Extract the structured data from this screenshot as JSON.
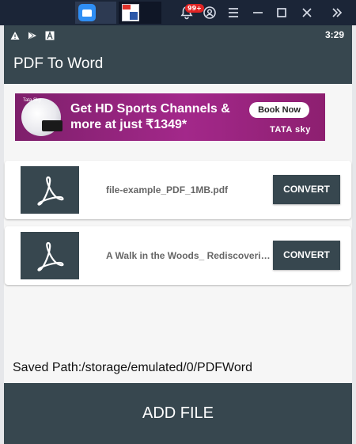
{
  "emulator": {
    "notification_badge": "99+"
  },
  "status_bar": {
    "time": "3:29",
    "icons": [
      "warning-icon",
      "play-store-icon",
      "font-icon"
    ]
  },
  "app_bar": {
    "title": "PDF To Word"
  },
  "ad_banner": {
    "headline": "Get HD Sports Channels & more at just ₹1349*",
    "cta": "Book Now",
    "brand": "TATA sky",
    "mini_logo": "Tata Sky"
  },
  "files": [
    {
      "name": "file-example_PDF_1MB.pdf",
      "action": "CONVERT"
    },
    {
      "name": "A Walk in the Woods_ Rediscovering America on the Appalachian Trail.pdf",
      "action": "CONVERT"
    }
  ],
  "saved_path": "Saved Path:/storage/emulated/0/PDFWord",
  "add_file_label": "ADD FILE",
  "colors": {
    "primary": "#37474f",
    "emulator_bar": "#1b2537",
    "badge": "#e02424",
    "ad_background": "#a3288a"
  }
}
